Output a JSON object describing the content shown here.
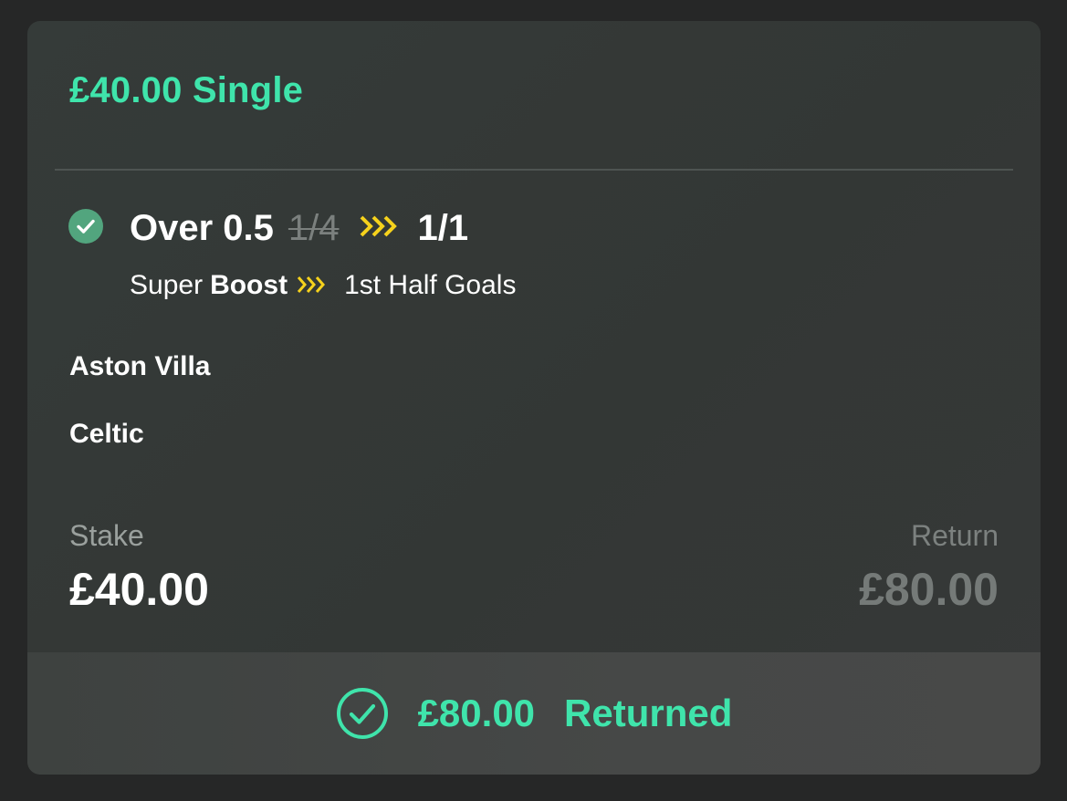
{
  "bet": {
    "title": "£40.00 Single",
    "selection": {
      "name": "Over 0.5",
      "old_odds": "1/4",
      "new_odds": "1/1",
      "result_icon": "check-circle-icon"
    },
    "boost": {
      "prefix": "Super",
      "label": "Boost",
      "icon": "triple-chevron-icon"
    },
    "market": "1st Half Goals",
    "teams": [
      "Aston Villa",
      "Celtic"
    ],
    "stake_label": "Stake",
    "stake_value": "£40.00",
    "return_label": "Return",
    "return_value": "£80.00"
  },
  "footer": {
    "icon": "check-outline-icon",
    "amount": "£80.00",
    "status": "Returned"
  },
  "colors": {
    "accent": "#3fe4ab",
    "boost": "#f6d21c",
    "won_dot": "#52a57e"
  }
}
